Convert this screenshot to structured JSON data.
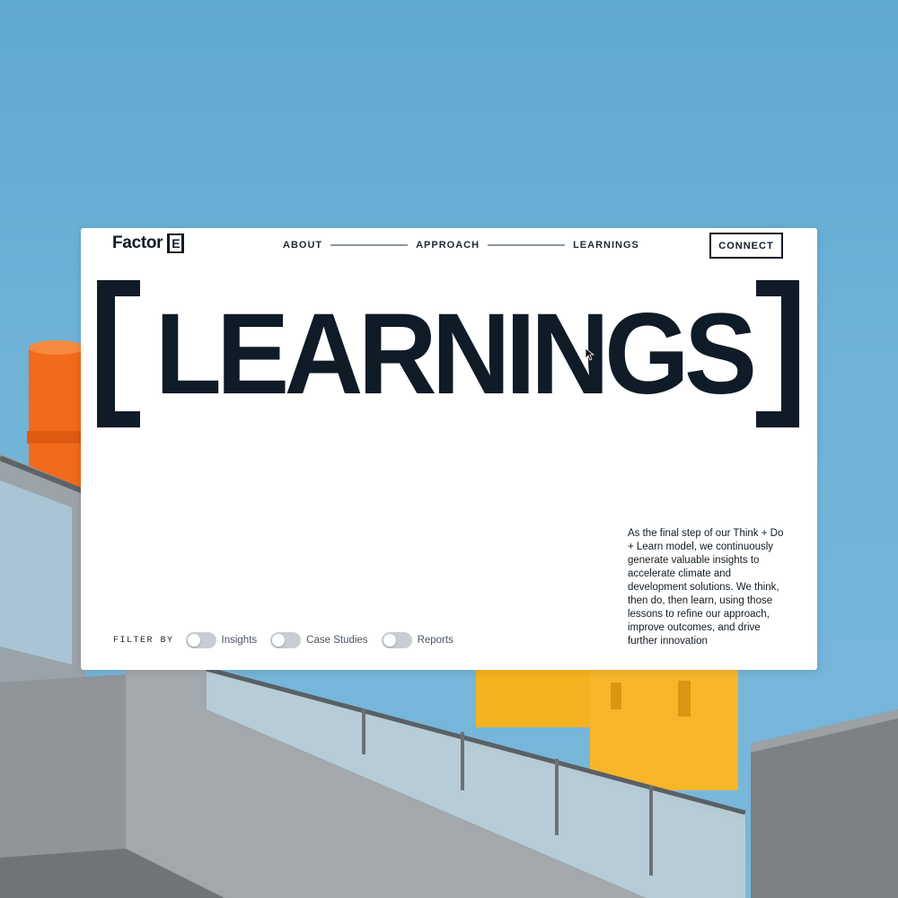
{
  "brand": {
    "name": "Factor",
    "mark": "E"
  },
  "nav": {
    "items": [
      {
        "label": "ABOUT"
      },
      {
        "label": "APPROACH"
      },
      {
        "label": "LEARNINGS"
      }
    ],
    "cta_label": "CONNECT"
  },
  "hero": {
    "title": "LEARNINGS"
  },
  "description": "As the final step of our Think + Do + Learn model, we continuously generate valuable insights to accelerate climate and development solutions. We think, then do, then learn, using those lessons to refine our approach, improve outcomes, and drive further innovation",
  "filters": {
    "label": "FILTER BY",
    "options": [
      {
        "label": "Insights",
        "on": false
      },
      {
        "label": "Case Studies",
        "on": false
      },
      {
        "label": "Reports",
        "on": false
      }
    ]
  },
  "colors": {
    "sky": "#6fb3d8",
    "ink": "#0f1b26",
    "orange_pipe": "#f26a1b",
    "yellow_pipe": "#f5b321",
    "building_gray": "#8f9599",
    "toggle_off": "#c8cdd3"
  }
}
